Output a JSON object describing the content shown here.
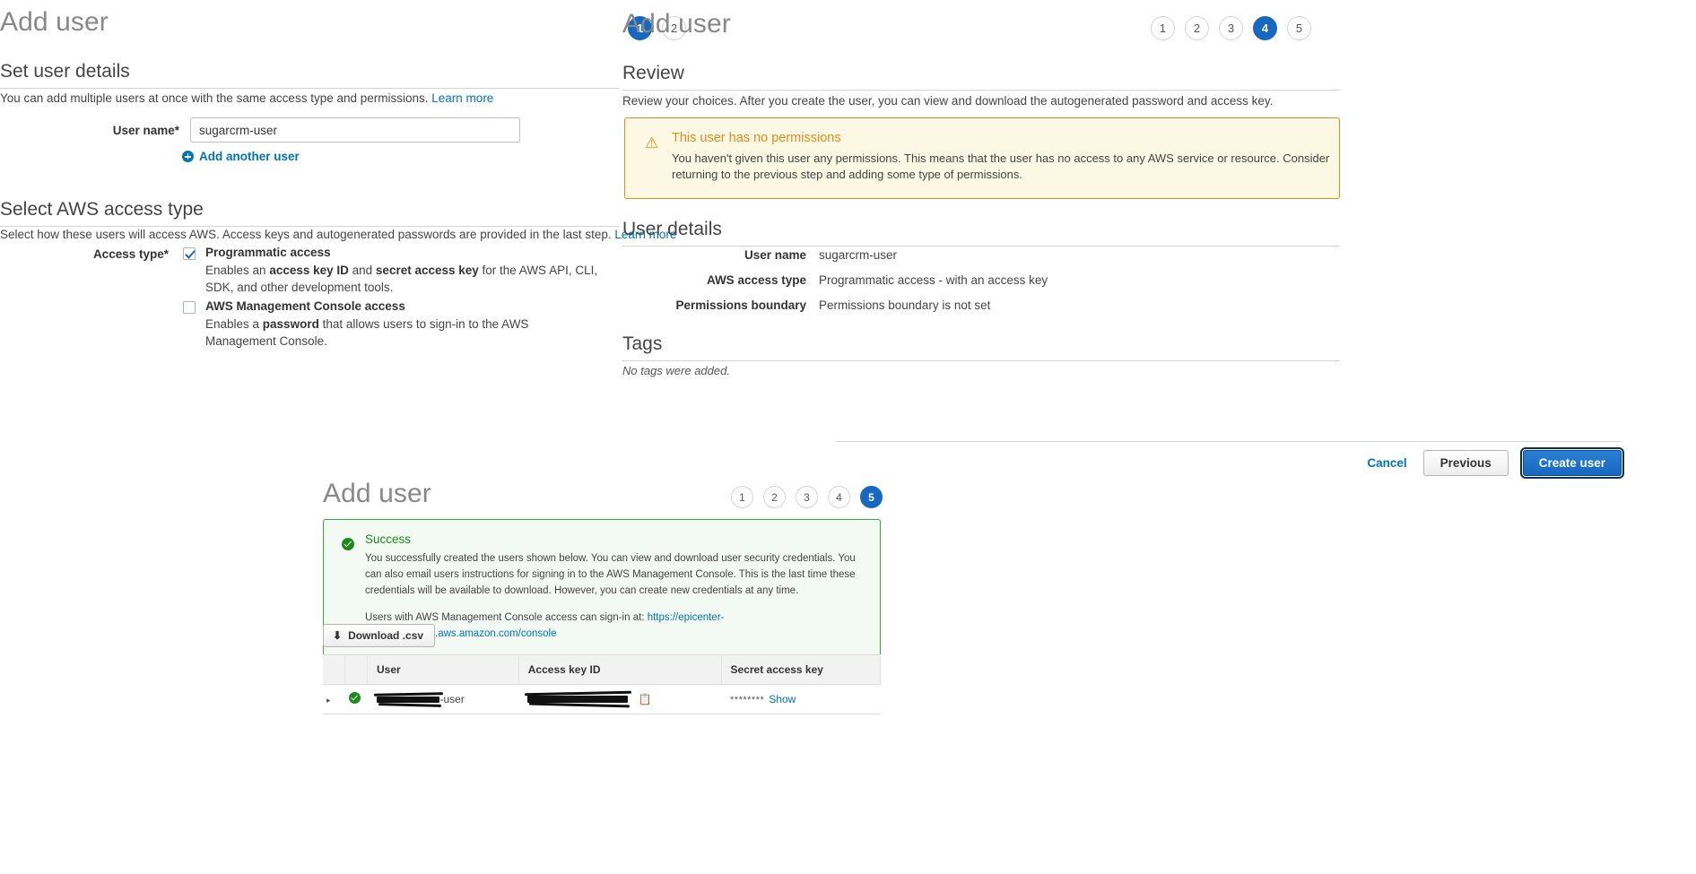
{
  "left_panel": {
    "title": "Add user",
    "steps": [
      {
        "label": "1",
        "active": true
      },
      {
        "label": "2",
        "active": false
      }
    ],
    "set_user_details": {
      "heading": "Set user details",
      "description": "You can add multiple users at once with the same access type and permissions.",
      "learn_more": "Learn more",
      "username_label": "User name*",
      "username_value": "sugarcrm-user",
      "username_placeholder": "",
      "add_another_user": "Add another user"
    },
    "access_type": {
      "heading": "Select AWS access type",
      "description": "Select how these users will access AWS. Access keys and autogenerated passwords are provided in the last step.",
      "learn_more": "Learn more",
      "field_label": "Access type*",
      "options": [
        {
          "title": "Programmatic access",
          "checked": true,
          "desc_part1": "Enables an ",
          "desc_bold1": "access key ID",
          "desc_part2": " and ",
          "desc_bold2": "secret access key",
          "desc_part3": " for the AWS API, CLI, SDK, and other development tools."
        },
        {
          "title": "AWS Management Console access",
          "checked": false,
          "desc_part1": "Enables a ",
          "desc_bold1": "password",
          "desc_part2": " that allows users to sign-in to the AWS Management Console.",
          "desc_bold2": "",
          "desc_part3": ""
        }
      ]
    }
  },
  "right_panel": {
    "title": "Add user",
    "steps": [
      {
        "label": "1",
        "active": false
      },
      {
        "label": "2",
        "active": false
      },
      {
        "label": "3",
        "active": false
      },
      {
        "label": "4",
        "active": true
      },
      {
        "label": "5",
        "active": false
      }
    ],
    "review": {
      "heading": "Review",
      "description": "Review your choices. After you create the user, you can view and download the autogenerated password and access key."
    },
    "warning": {
      "icon": "warning-triangle-icon",
      "title": "This user has no permissions",
      "body": "You haven't given this user any permissions. This means that the user has no access to any AWS service or resource. Consider returning to the previous step and adding some type of permissions.",
      "border_color": "#e08c1c",
      "background_color": "#fdf8e3"
    },
    "user_details": {
      "heading": "User details",
      "rows": [
        {
          "key": "User name",
          "value": "sugarcrm-user"
        },
        {
          "key": "AWS access type",
          "value": "Programmatic access - with an access key"
        },
        {
          "key": "Permissions boundary",
          "value": "Permissions boundary is not set"
        }
      ]
    },
    "tags": {
      "heading": "Tags",
      "empty": "No tags were added."
    },
    "actions": {
      "cancel": "Cancel",
      "previous": "Previous",
      "create_user": "Create user",
      "primary_color": "#1668c1"
    }
  },
  "bottom_panel": {
    "title": "Add user",
    "steps": [
      {
        "label": "1",
        "active": false
      },
      {
        "label": "2",
        "active": false
      },
      {
        "label": "3",
        "active": false
      },
      {
        "label": "4",
        "active": false
      },
      {
        "label": "5",
        "active": true
      }
    ],
    "success": {
      "icon": "check-circle-icon",
      "title": "Success",
      "body": "You successfully created the users shown below. You can view and download user security credentials. You can also email users instructions for signing in to the AWS Management Console. This is the last time these credentials will be available to download. However, you can create new credentials at any time.",
      "signin_prefix": "Users with AWS Management Console access can sign-in at:",
      "signin_url": "https://epicenter-truebook.signin.aws.amazon.com/console",
      "border_color": "#3aa83a",
      "background_color": "#f3faf3"
    },
    "download_csv": "Download .csv",
    "credentials_table": {
      "columns": [
        "",
        "",
        "User",
        "Access key ID",
        "Secret access key"
      ],
      "rows": [
        {
          "expand": "▸",
          "status": "success",
          "user_redacted": true,
          "user_suffix": "-user",
          "access_key_redacted": true,
          "copy_icon": "copy-icon",
          "secret_mask": "********",
          "show_label": "Show"
        }
      ]
    }
  }
}
